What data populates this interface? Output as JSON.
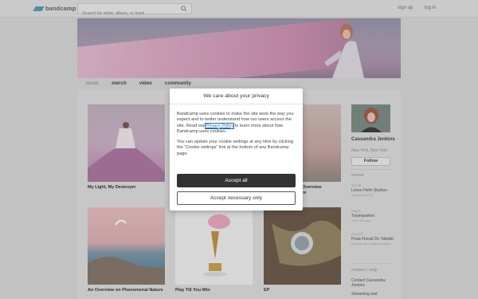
{
  "header": {
    "logo_text": "bandcamp",
    "search_placeholder": "Search for artist, album, or track",
    "signup": "sign up",
    "login": "log in"
  },
  "nav": {
    "tabs": [
      "music",
      "merch",
      "video",
      "community"
    ]
  },
  "albums": [
    {
      "title": "My Light, My Destroyer"
    },
    {
      "title": "An Overview on Phenomenal Nature"
    },
    {
      "title": "Play Till You Win"
    },
    {
      "title": "EP"
    },
    {
      "title_partial": ") An Overview",
      "title_partial2": "Nature"
    }
  ],
  "artist": {
    "name": "Cassandra Jenkins",
    "location": "New York, New York",
    "follow": "Follow"
  },
  "shows_heading": "shows",
  "shows": [
    {
      "date": "Jul 19",
      "venue": "Levon Helm Studios",
      "city": "Woodstock, NY"
    },
    {
      "date": "Aug 6",
      "venue": "Tøyenparken",
      "city": "Oslo, Norway"
    },
    {
      "date": "Aug 13",
      "venue": "Praia Fluvial Do Taboão",
      "city": "Paredes de Coura, Portugal"
    }
  ],
  "contact_heading": "contact / help",
  "contact_links": [
    "Contact Cassandra Jenkins",
    "Streaming and"
  ],
  "cookie_dialog": {
    "title": "We care about your privacy",
    "para1_before": "Bandcamp uses cookies to make the site work the way you expect and to better understand how our users access the site. Read our ",
    "policy_link": "Privacy Policy",
    "para1_after": " to learn more about how Bandcamp uses cookies.",
    "para2": "You can update your cookie settings at any time by clicking the “Cookie settings” link at the bottom of any Bandcamp page.",
    "accept_all": "Accept all",
    "accept_necessary": "Accept necessary only"
  }
}
